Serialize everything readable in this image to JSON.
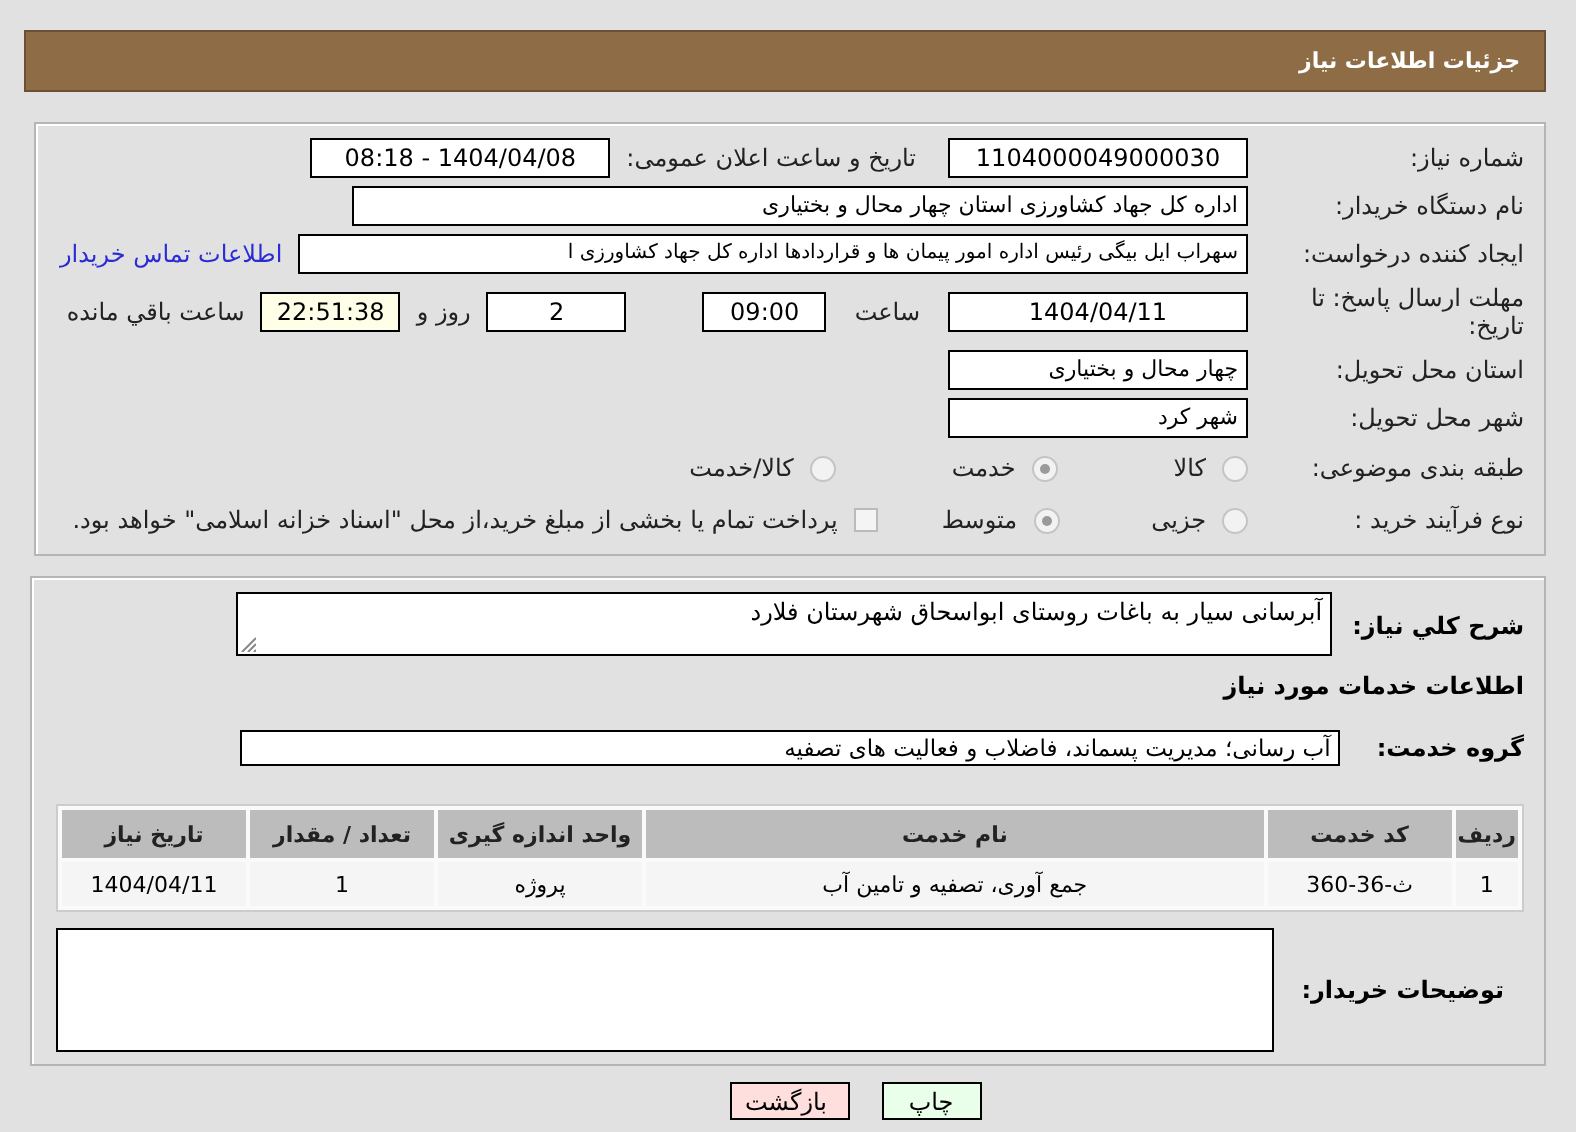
{
  "header": {
    "title": "جزئیات اطلاعات نیاز"
  },
  "need_number": {
    "label": "شماره نیاز:",
    "value": "1104000049000030"
  },
  "announce": {
    "label": "تاریخ و ساعت اعلان عمومی:",
    "value": "1404/04/08 - 08:18"
  },
  "buyer": {
    "label": "نام دستگاه خریدار:",
    "value": "اداره کل جهاد کشاورزی استان چهار محال و بختیاری"
  },
  "creator": {
    "label": "ایجاد کننده درخواست:",
    "value": "سهراب ایل بیگی رئیس اداره امور پیمان ها و قراردادها اداره کل جهاد کشاورزی ا",
    "link": "اطلاعات تماس خریدار"
  },
  "deadline": {
    "label": "مهلت ارسال پاسخ: تا تاریخ:",
    "date": "1404/04/11",
    "time_label": "ساعت",
    "time": "09:00",
    "days": "2",
    "days_label": "روز و",
    "remaining": "22:51:38",
    "remaining_label": "ساعت باقي مانده"
  },
  "province": {
    "label": "استان محل تحویل:",
    "value": "چهار محال و بختیاری"
  },
  "city": {
    "label": "شهر محل تحویل:",
    "value": "شهر کرد"
  },
  "category": {
    "label": "طبقه بندی موضوعی:",
    "options": [
      {
        "label": "کالا",
        "selected": false
      },
      {
        "label": "خدمت",
        "selected": true
      },
      {
        "label": "کالا/خدمت",
        "selected": false
      }
    ]
  },
  "process": {
    "label": "نوع فرآیند خرید :",
    "options": [
      {
        "label": "جزیی",
        "selected": false
      },
      {
        "label": "متوسط",
        "selected": true
      }
    ],
    "payment": {
      "checked": false,
      "text": "پرداخت تمام یا بخشی از مبلغ خرید،از محل \"اسناد خزانه اسلامی\" خواهد بود."
    }
  },
  "description": {
    "label": "شرح کلي نياز:",
    "value": "آبرسانی سیار به باغات روستای ابواسحاق شهرستان فلارد"
  },
  "services_title": "اطلاعات خدمات مورد نياز",
  "service_group": {
    "label": "گروه خدمت:",
    "value": "آب رسانی؛ مدیریت پسماند، فاضلاب و فعالیت های تصفیه"
  },
  "table": {
    "columns": [
      "رديف",
      "کد خدمت",
      "نام خدمت",
      "واحد اندازه گیری",
      "تعداد / مقدار",
      "تاریخ نیاز"
    ],
    "rows": [
      [
        "1",
        "ث-36-360",
        "جمع آوری، تصفیه و تامین آب",
        "پروژه",
        "1",
        "1404/04/11"
      ]
    ]
  },
  "buyer_notes": {
    "label": "توضیحات خریدار:"
  },
  "buttons": [
    {
      "label": "چاپ",
      "kind": "print"
    },
    {
      "label": "بازگشت",
      "kind": "back"
    }
  ]
}
